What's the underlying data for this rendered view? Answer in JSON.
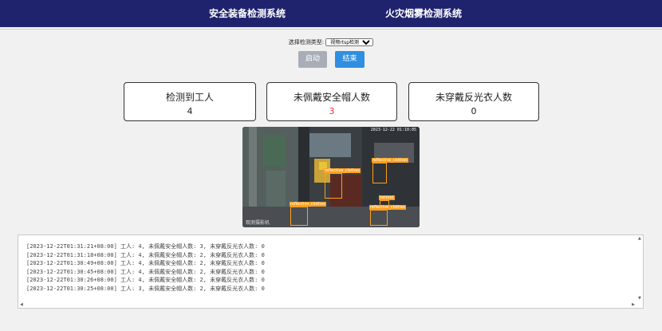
{
  "nav": {
    "item1": "安全装备检测系统",
    "item2": "火灾烟雾检测系统",
    "bg_color": "#1f236e"
  },
  "controls": {
    "select_label": "选择检测类型:",
    "select_value": "视频rtsp检测",
    "start_label": "启动",
    "stop_label": "结束"
  },
  "stats": [
    {
      "title": "检测到工人",
      "value": "4",
      "color": "#222222"
    },
    {
      "title": "未佩戴安全帽人数",
      "value": "3",
      "color": "#e53935"
    },
    {
      "title": "未穿戴反光衣人数",
      "value": "0",
      "color": "#222222"
    }
  ],
  "video": {
    "timestamp": "2023-12-22 01:10:05",
    "watermark": "观测摄影机",
    "detections": [
      "reflective_clothes",
      "reflective_clothes",
      "reflective_clothes",
      "helmet",
      "reflective_clothes"
    ],
    "box_color": "#ff9f1a"
  },
  "log": {
    "lines": [
      "[2023-12-22T01:31:21+08:00] 工人: 4, 未佩戴安全帽人数: 3, 未穿戴反光衣人数: 0",
      "[2023-12-22T01:31:18+08:00] 工人: 4, 未佩戴安全帽人数: 2, 未穿戴反光衣人数: 0",
      "[2023-12-22T01:30:49+08:00] 工人: 4, 未佩戴安全帽人数: 2, 未穿戴反光衣人数: 0",
      "[2023-12-22T01:30:45+08:00] 工人: 4, 未佩戴安全帽人数: 2, 未穿戴反光衣人数: 0",
      "[2023-12-22T01:30:26+08:00] 工人: 4, 未佩戴安全帽人数: 2, 未穿戴反光衣人数: 0",
      "[2023-12-22T01:30:25+08:00] 工人: 3, 未佩戴安全帽人数: 2, 未穿戴反光衣人数: 0"
    ]
  }
}
